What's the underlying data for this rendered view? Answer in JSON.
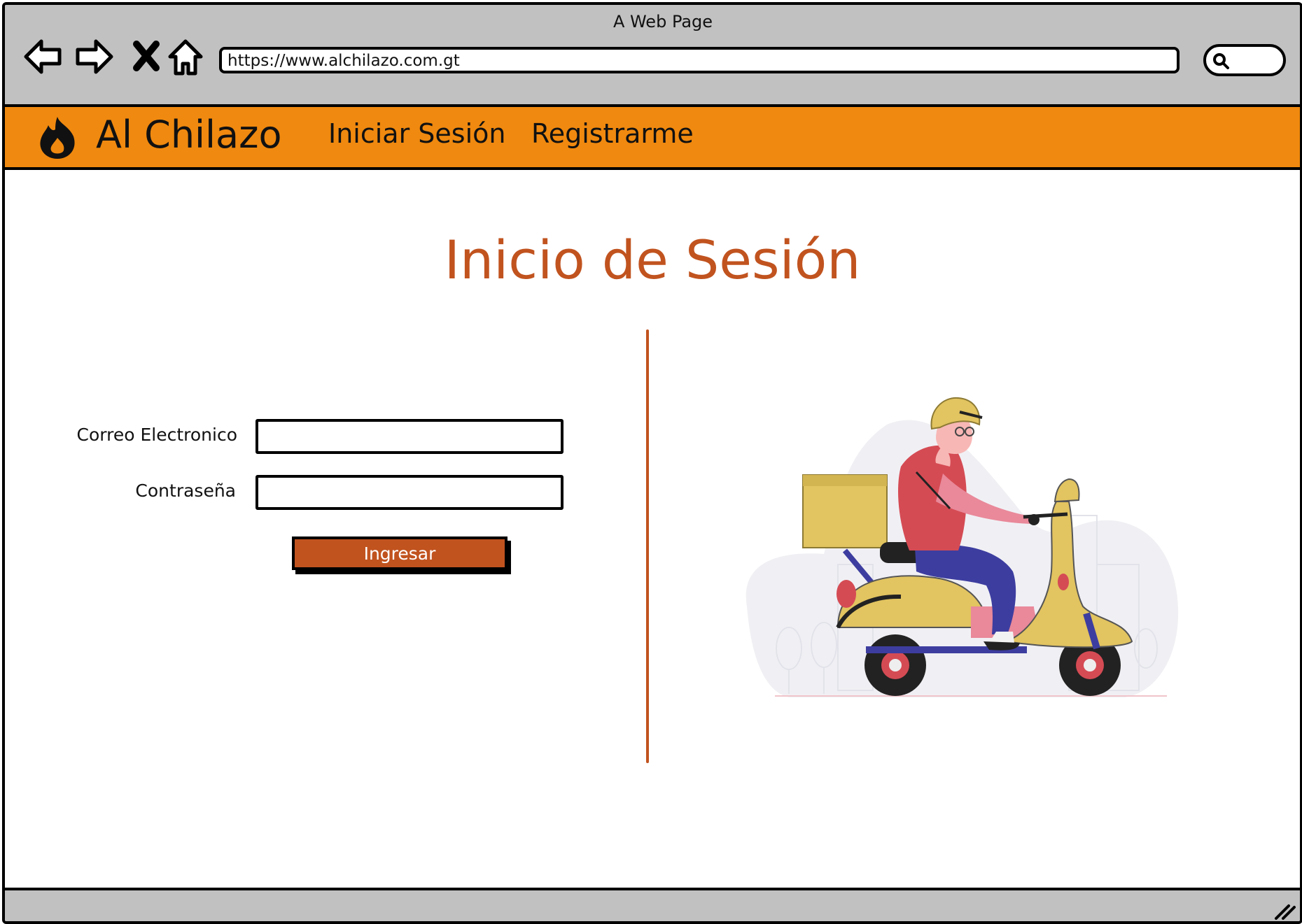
{
  "window": {
    "title": "A Web Page"
  },
  "browser": {
    "url": "https://www.alchilazo.com.gt",
    "icons": [
      "back-arrow-icon",
      "forward-arrow-icon",
      "close-x-icon",
      "home-icon",
      "search-icon"
    ]
  },
  "navbar": {
    "brand": "Al Chilazo",
    "brand_icon": "flame-icon",
    "links": [
      "Iniciar Sesión",
      "Registrarme"
    ],
    "color": "#f0890f"
  },
  "main": {
    "title": "Inicio de Sesión",
    "accent_color": "#c1531f",
    "form": {
      "email_label": "Correo Electronico",
      "email_value": "",
      "password_label": "Contraseña",
      "password_value": "",
      "submit_label": "Ingresar"
    },
    "illustration": "delivery-scooter-illustration"
  }
}
